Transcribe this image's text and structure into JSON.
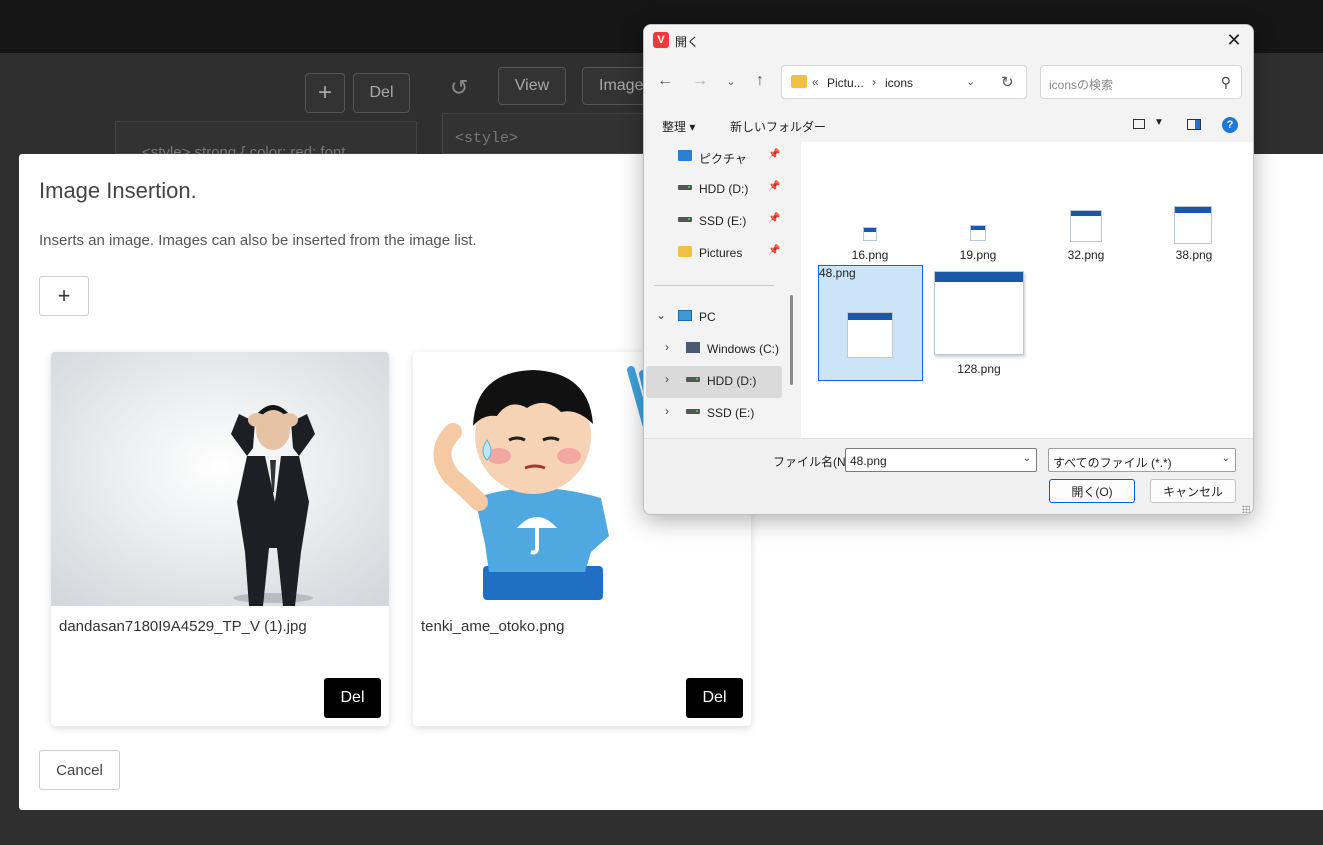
{
  "background": {
    "toolbar": {
      "add_label": "+",
      "del_label": "Del",
      "undo_icon": "undo-icon",
      "view_label": "View",
      "image_label": "Image"
    },
    "editor_left_snippet": "<style> strong { color: red; font",
    "editor_right_snippet": "<style>"
  },
  "modal": {
    "title": "Image Insertion.",
    "description": "Inserts an image. Images can also be inserted from the image list.",
    "add_label": "+",
    "cards": [
      {
        "filename": "dandasan7180I9A4529_TP_V (1).jpg",
        "del_label": "Del"
      },
      {
        "filename": "tenki_ame_otoko.png",
        "del_label": "Del"
      }
    ],
    "cancel_label": "Cancel"
  },
  "dialog": {
    "title": "開く",
    "app_icon_letter": "V",
    "address": {
      "chevron": "«",
      "segments": [
        "Pictu...",
        "icons"
      ],
      "separator": "›"
    },
    "search_placeholder": "iconsの検索",
    "toolbar": {
      "organize": "整理 ▾",
      "new_folder": "新しいフォルダー",
      "help": "?"
    },
    "nav": {
      "quick": [
        {
          "label": "ピクチャ",
          "icon": "pictures-icon"
        },
        {
          "label": "HDD (D:)",
          "icon": "drive-icon"
        },
        {
          "label": "SSD (E:)",
          "icon": "drive-icon"
        },
        {
          "label": "Pictures",
          "icon": "folder-icon"
        }
      ],
      "pc_label": "PC",
      "pc_children": [
        {
          "label": "Windows (C:)",
          "icon": "windows-drive-icon"
        },
        {
          "label": "HDD (D:)",
          "icon": "drive-icon"
        },
        {
          "label": "SSD (E:)",
          "icon": "drive-icon"
        }
      ]
    },
    "files": [
      {
        "name": "16.png"
      },
      {
        "name": "19.png"
      },
      {
        "name": "32.png"
      },
      {
        "name": "38.png"
      },
      {
        "name": "48.png",
        "selected": true
      },
      {
        "name": "128.png"
      }
    ],
    "filename_label": "ファイル名(N):",
    "filename_value": "48.png",
    "filetype_value": "すべてのファイル (*.*)",
    "open_label": "開く(O)",
    "cancel_label": "キャンセル"
  },
  "colors": {
    "selection_bg": "#cce4f7",
    "selection_border": "#0a6ed1",
    "accent": "#1b57a7",
    "del_button_bg": "#000000"
  }
}
